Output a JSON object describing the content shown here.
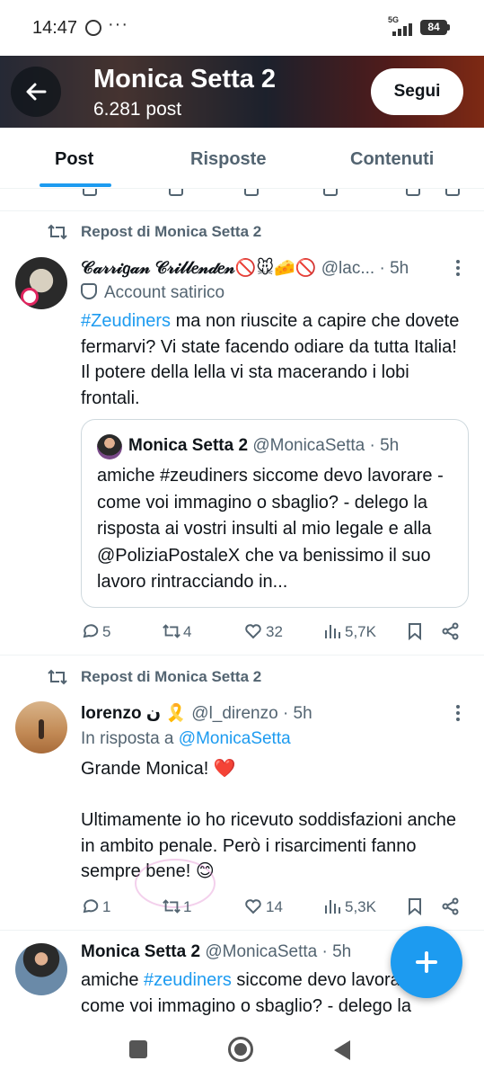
{
  "status": {
    "time": "14:47",
    "network": "5G",
    "battery": "84"
  },
  "header": {
    "title": "Monica Setta 2",
    "post_count": "6.281 post",
    "follow_label": "Segui"
  },
  "tabs": [
    {
      "label": "Post"
    },
    {
      "label": "Risposte"
    },
    {
      "label": "Contenuti"
    }
  ],
  "post1": {
    "repost_label": "Repost di Monica Setta 2",
    "name": "𝒞𝒶𝓇𝓇𝒾𝑔𝒶𝓃 𝒞𝓇𝒾𝓁𝓁𝑒𝓃𝒹𝑒𝓃🚫🐭🧀🚫",
    "handle": "@lac...",
    "time": "· 5h",
    "badge": "Account satirico",
    "hashtag": "#Zeudiners",
    "text": " ma non riuscite a capire che dovete fermarvi? Vi state facendo odiare da tutta Italia! Il potere della lella vi sta macerando i lobi frontali.",
    "quote": {
      "name": "Monica Setta 2",
      "handle": "@MonicaSetta · 5h",
      "text": "amiche #zeudiners siccome devo lavorare - come voi immagino o sbaglio? - delego la risposta ai vostri insulti al mio legale e alla @PoliziaPostaleX che va benissimo il suo lavoro rintracciando in..."
    },
    "stats": {
      "replies": "5",
      "reposts": "4",
      "likes": "32",
      "views": "5,7K"
    }
  },
  "post2": {
    "repost_label": "Repost di Monica Setta 2",
    "name": "lorenzo ن 🎗️",
    "handle": "@l_direnzo · 5h",
    "reply_prefix": "In risposta a ",
    "reply_to": "@MonicaSetta",
    "text": "Grande Monica! ❤️\n\nUltimamente io ho ricevuto soddisfazioni anche in ambito penale. Però i risarcimenti fanno sempre bene! 😊",
    "stats": {
      "replies": "1",
      "reposts": "1",
      "likes": "14",
      "views": "5,3K"
    }
  },
  "post3": {
    "name": "Monica Setta 2",
    "handle": "@MonicaSetta · 5h",
    "text_prefix": "amiche ",
    "hashtag": "#zeudiners",
    "text_suffix": " siccome devo lavorare - come voi immagino o sbaglio? - delego la"
  }
}
